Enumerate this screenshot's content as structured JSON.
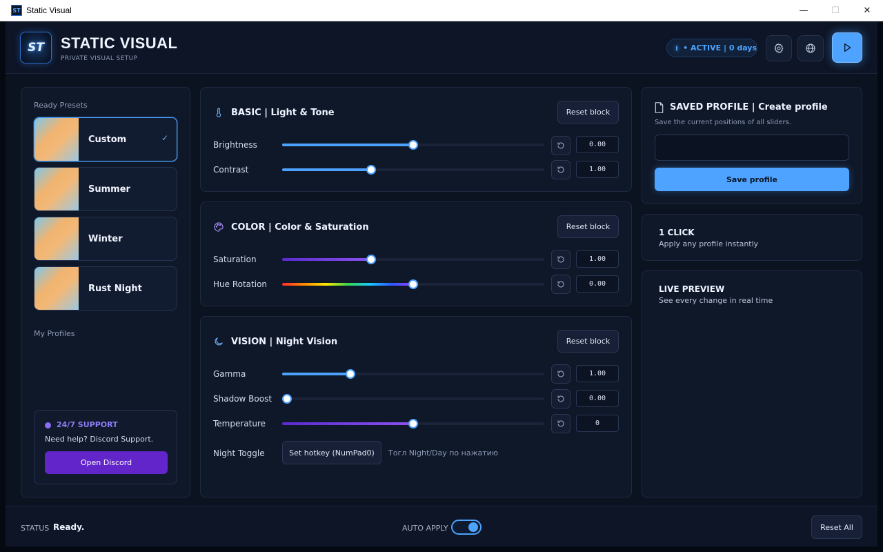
{
  "window": {
    "title": "Static Visual",
    "icon_text": "ST",
    "minimize": "—",
    "maximize": "☐",
    "close": "✕"
  },
  "header": {
    "logo_text": "ST",
    "title": "STATIC VISUAL",
    "subtitle": "PRIVATE VISUAL SETUP",
    "status": "• ACTIVE | 0 days",
    "icons": [
      "gear-icon",
      "globe-icon",
      "play-icon"
    ]
  },
  "presets": {
    "label": "Ready Presets",
    "items": [
      {
        "name": "Custom",
        "active": true
      },
      {
        "name": "Summer",
        "active": false
      },
      {
        "name": "Winter",
        "active": false
      },
      {
        "name": "Rust Night",
        "active": false
      }
    ],
    "check": "✓",
    "my_profiles_label": "My Profiles"
  },
  "support": {
    "title": "24/7 SUPPORT",
    "text": "Need help? Discord Support.",
    "button": "Open Discord"
  },
  "basic": {
    "title": "BASIC | Light & Tone",
    "reset": "Reset block",
    "rows": [
      {
        "label": "Brightness",
        "value": "0.00",
        "level": 0.5
      },
      {
        "label": "Contrast",
        "value": "1.00",
        "level": 0.34
      }
    ]
  },
  "color": {
    "title": "COLOR | Color & Saturation",
    "reset": "Reset block",
    "rows": [
      {
        "label": "Saturation",
        "value": "1.00",
        "level": 0.34
      },
      {
        "label": "Hue Rotation",
        "value": "0.00",
        "level": 0.5
      }
    ]
  },
  "vision": {
    "title": "VISION | Night Vision",
    "reset": "Reset block",
    "rows": [
      {
        "label": "Gamma",
        "value": "1.00",
        "level": 0.26
      },
      {
        "label": "Shadow Boost",
        "value": "0.00",
        "level": 0.0
      },
      {
        "label": "Temperature",
        "value": "0",
        "level": 0.5
      }
    ],
    "toggle_label": "Night Toggle",
    "hotkey_button": "Set hotkey (NumPad0)",
    "hotkey_hint": "Тогл Night/Day по нажатию"
  },
  "saved_profile": {
    "title": "SAVED PROFILE | Create profile",
    "subtitle": "Save the current positions of all sliders.",
    "input_value": "",
    "save_button": "Save profile"
  },
  "one_click": {
    "title": "1 CLICK",
    "subtitle": "Apply any profile instantly"
  },
  "live_preview": {
    "title": "LIVE PREVIEW",
    "subtitle": "See every change in real time"
  },
  "footer": {
    "status_label": "STATUS",
    "status_value": "Ready.",
    "auto_apply_label": "AUTO APPLY",
    "auto_apply_on": true,
    "reset_all": "Reset All"
  },
  "colors": {
    "accent": "#4da3ff",
    "purple": "#6225c9",
    "background": "#0b1220"
  }
}
